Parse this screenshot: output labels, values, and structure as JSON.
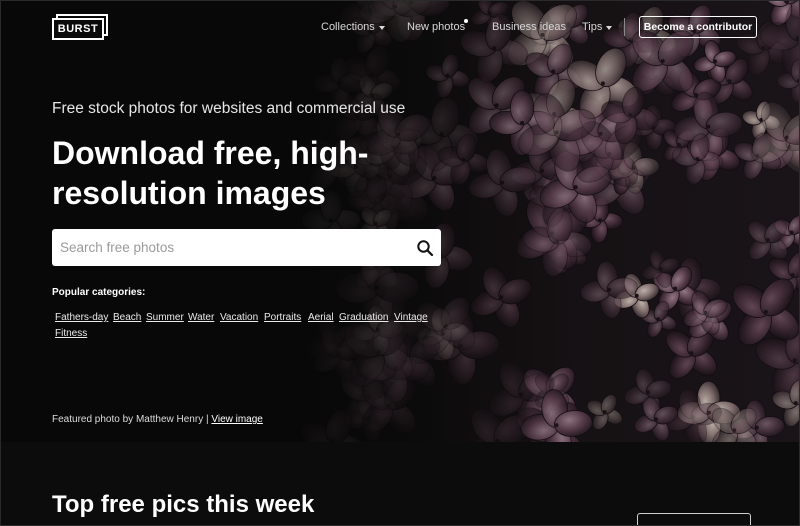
{
  "header": {
    "logo_text": "BURST",
    "nav": [
      {
        "label": "Collections",
        "has_caret": true
      },
      {
        "label": "New photos",
        "has_dot": true
      },
      {
        "label": "Business ideas"
      },
      {
        "label": "Tips",
        "has_caret": true
      }
    ],
    "cta_label": "Become a contributor"
  },
  "hero": {
    "tagline": "Free stock photos for websites and commercial use",
    "headline": "Download free, high-resolution images",
    "search": {
      "placeholder": "Search free photos",
      "value": "",
      "icon": "search-icon"
    },
    "popular_label": "Popular categories:",
    "categories": [
      "Fathers-day",
      "Beach",
      "Summer",
      "Water",
      "Vacation",
      "Portraits",
      "Aerial",
      "Graduation",
      "Vintage",
      "Fitness"
    ],
    "credit": {
      "prefix": "Featured photo by Matthew Henry |",
      "link_label": "View image"
    }
  },
  "section": {
    "title": "Top free pics this week"
  },
  "colors": {
    "background": "#0c0c0c",
    "text": "#ffffff",
    "petal": "#5a3f4c",
    "petal_light": "#b9a7aa"
  }
}
